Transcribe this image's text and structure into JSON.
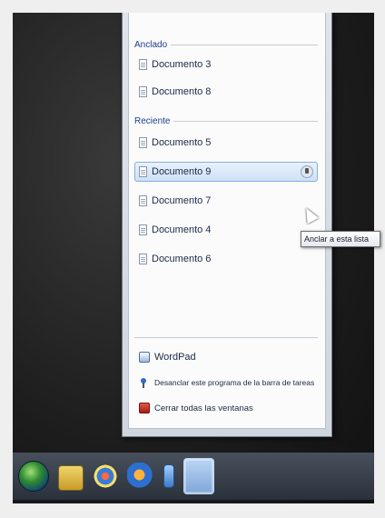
{
  "jumplist": {
    "pinned_header": "Anclado",
    "pinned_items": [
      {
        "label": "Documento 3"
      },
      {
        "label": "Documento 8"
      }
    ],
    "recent_header": "Reciente",
    "recent_items": [
      {
        "label": "Documento 5"
      },
      {
        "label": "Documento 9"
      },
      {
        "label": "Documento 7"
      },
      {
        "label": "Documento 4"
      },
      {
        "label": "Documento 6"
      }
    ],
    "tasks": [
      {
        "label": "WordPad",
        "icon": "wordpad-icon"
      },
      {
        "label": "Desanclar este programa de la barra de tareas",
        "icon": "unpin-icon"
      },
      {
        "label": "Cerrar todas las ventanas",
        "icon": "close-window-icon"
      }
    ]
  },
  "tooltip": {
    "text": "Anclar a esta lista"
  },
  "taskbar": {
    "items": [
      "start-orb",
      "explorer-icon",
      "paint-icon",
      "media-player-icon",
      "notepad-icon",
      "wordpad-icon"
    ]
  }
}
